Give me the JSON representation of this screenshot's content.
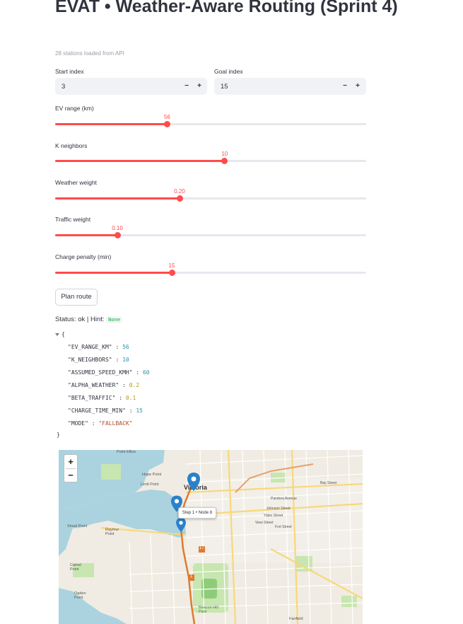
{
  "app": {
    "title": "EVAT • Weather-Aware Routing (Sprint 4)",
    "caption": "28 stations loaded from API"
  },
  "inputs": {
    "start": {
      "label": "Start index",
      "value": "3",
      "minus": "−",
      "plus": "+"
    },
    "goal": {
      "label": "Goal index",
      "value": "15",
      "minus": "−",
      "plus": "+"
    }
  },
  "sliders": {
    "ev_range": {
      "label": "EV range (km)",
      "value": "56",
      "fraction": 0.36
    },
    "k_neighbors": {
      "label": "K neighbors",
      "value": "10",
      "fraction": 0.545
    },
    "weather_weight": {
      "label": "Weather weight",
      "value": "0.20",
      "fraction": 0.4
    },
    "traffic_weight": {
      "label": "Traffic weight",
      "value": "0.10",
      "fraction": 0.2
    },
    "charge_penalty": {
      "label": "Charge penalty (min)",
      "value": "15",
      "fraction": 0.375
    }
  },
  "actions": {
    "plan_route": "Plan route"
  },
  "status": {
    "prefix": "Status: ok | Hint:",
    "hint": "None"
  },
  "json_output": {
    "open": "{",
    "close": "}",
    "entries": [
      {
        "key": "\"EV_RANGE_KM\"",
        "value": "56",
        "kind": "n"
      },
      {
        "key": "\"K_NEIGHBORS\"",
        "value": "10",
        "kind": "n"
      },
      {
        "key": "\"ASSUMED_SPEED_KMH\"",
        "value": "60",
        "kind": "n"
      },
      {
        "key": "\"ALPHA_WEATHER\"",
        "value": "0.2",
        "kind": "f"
      },
      {
        "key": "\"BETA_TRAFFIC\"",
        "value": "0.1",
        "kind": "f"
      },
      {
        "key": "\"CHARGE_TIME_MIN\"",
        "value": "15",
        "kind": "n"
      },
      {
        "key": "\"MODE\"",
        "value": "\"FALLBACK\"",
        "kind": "s"
      }
    ]
  },
  "map": {
    "zoom_in": "+",
    "zoom_out": "−",
    "tooltip": "Step 1 • Node 8",
    "labels": {
      "point_ellice": "Point Ellice",
      "victoria": "Victoria",
      "hope_point": "Hope Point",
      "limit_point": "Limit Point",
      "shoal_point": "Shoal Point",
      "raymur_point": "Raymur Point",
      "camel_point": "Camel Point",
      "ogden_point": "Ogden Point",
      "beacon_hill_park": "Beacon Hill Park",
      "pandora_avenue": "Pandora Avenue",
      "johnson_street": "Johnson Street",
      "yates_street": "Yates Street",
      "view_street": "View Street",
      "fort_street": "Fort Street",
      "bay_street": "Bay Street",
      "fairfield": "Fairfield",
      "route_17": "17",
      "route_1": "1"
    },
    "colors": {
      "marker": "#2a81cb",
      "route": "#e07a2e",
      "park": "#c8e6b0",
      "water": "#aad3df"
    }
  }
}
